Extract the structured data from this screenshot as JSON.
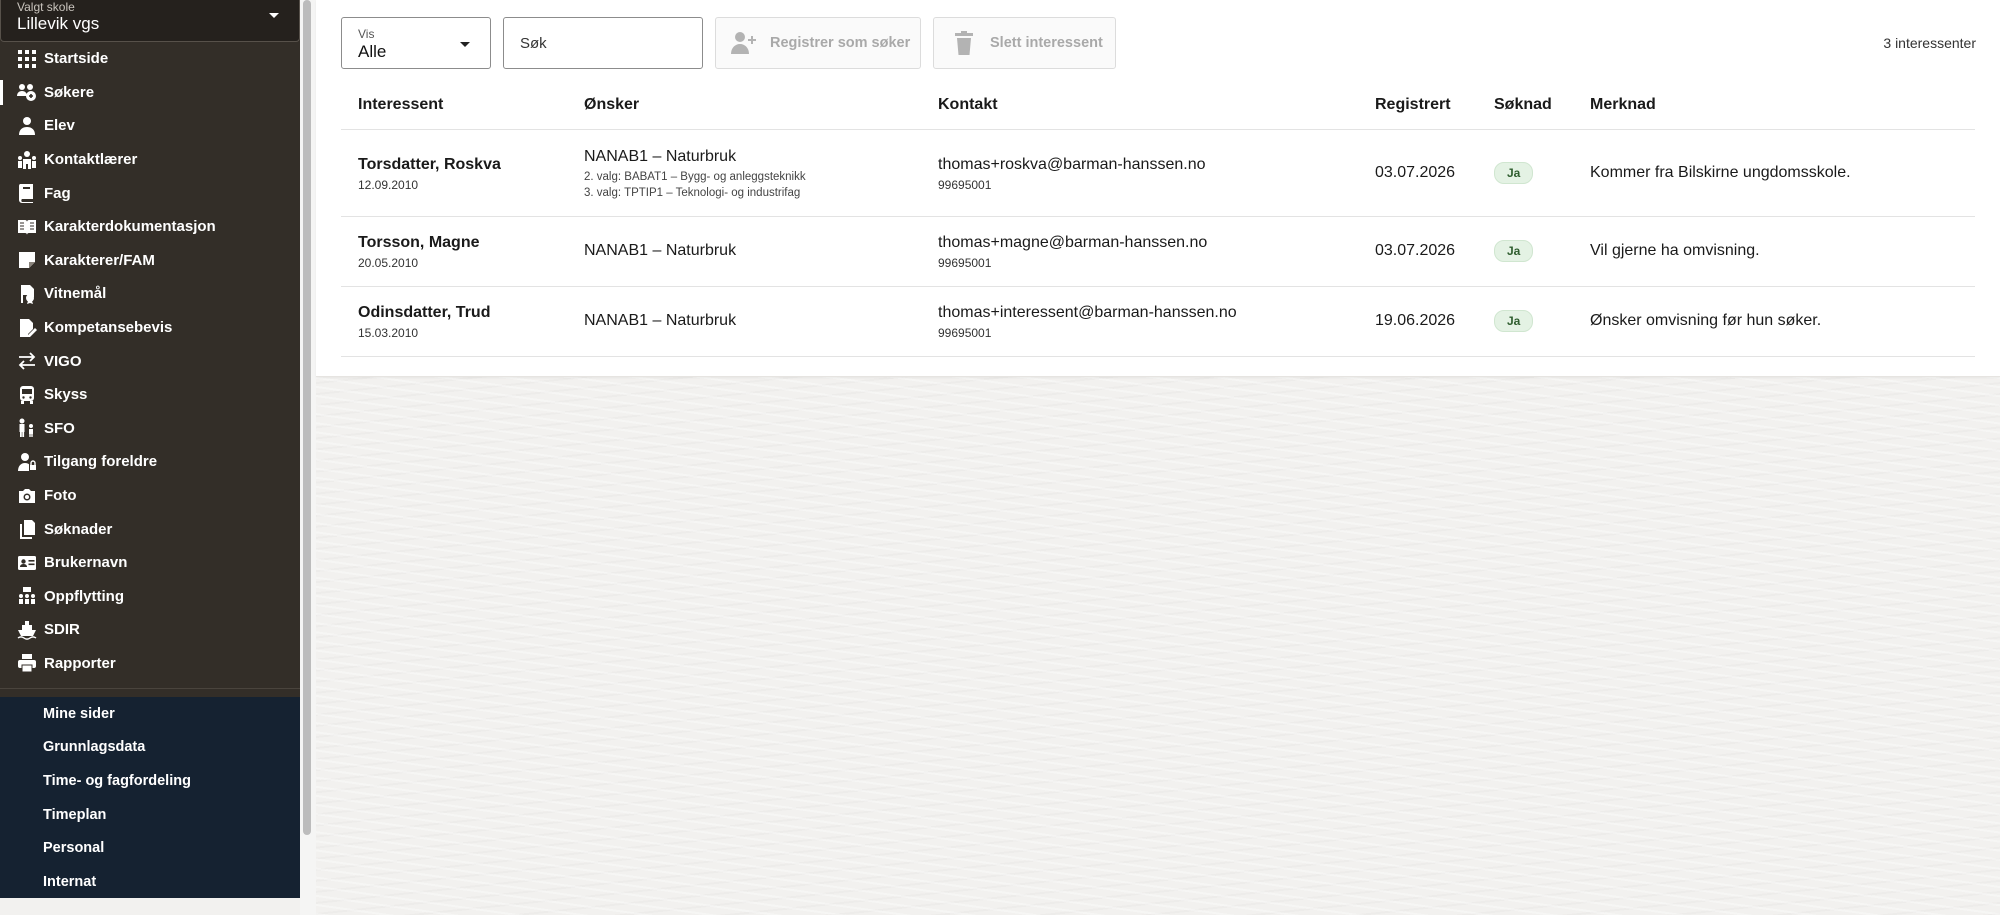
{
  "sidebar": {
    "school_select": {
      "label": "Valgt skole",
      "value": "Lillevik vgs"
    },
    "items": [
      {
        "label": "Startside",
        "icon": "grid-icon"
      },
      {
        "label": "Søkere",
        "icon": "applicants-icon"
      },
      {
        "label": "Elev",
        "icon": "person-icon"
      },
      {
        "label": "Kontaktlærer",
        "icon": "teacher-icon"
      },
      {
        "label": "Fag",
        "icon": "book-icon"
      },
      {
        "label": "Karakterdokumentasjon",
        "icon": "open-book-icon"
      },
      {
        "label": "Karakterer/FAM",
        "icon": "note-icon"
      },
      {
        "label": "Vitnemål",
        "icon": "diploma-icon"
      },
      {
        "label": "Kompetansebevis",
        "icon": "certificate-icon"
      },
      {
        "label": "VIGO",
        "icon": "swap-arrows-icon"
      },
      {
        "label": "Skyss",
        "icon": "bus-icon"
      },
      {
        "label": "SFO",
        "icon": "family-icon"
      },
      {
        "label": "Tilgang foreldre",
        "icon": "user-lock-icon"
      },
      {
        "label": "Foto",
        "icon": "camera-icon"
      },
      {
        "label": "Søknader",
        "icon": "documents-icon"
      },
      {
        "label": "Brukernavn",
        "icon": "id-card-icon"
      },
      {
        "label": "Oppflytting",
        "icon": "classroom-icon"
      },
      {
        "label": "SDIR",
        "icon": "ship-icon"
      },
      {
        "label": "Rapporter",
        "icon": "printer-icon"
      }
    ],
    "active_index": 1,
    "bottom_items": [
      {
        "label": "Mine sider"
      },
      {
        "label": "Grunnlagsdata"
      },
      {
        "label": "Time- og fagfordeling"
      },
      {
        "label": "Timeplan"
      },
      {
        "label": "Personal"
      },
      {
        "label": "Internat"
      }
    ]
  },
  "toolbar": {
    "vis_select": {
      "label": "Vis",
      "value": "Alle"
    },
    "search": {
      "placeholder": "Søk"
    },
    "register_label": "Registrer som søker",
    "delete_label": "Slett interessent",
    "count_text": "3 interessenter"
  },
  "table": {
    "headers": {
      "interessent": "Interessent",
      "onsker": "Ønsker",
      "kontakt": "Kontakt",
      "registrert": "Registrert",
      "soknad": "Søknad",
      "merknad": "Merknad"
    },
    "rows": [
      {
        "name": "Torsdatter, Roskva",
        "birthdate": "12.09.2010",
        "wish": "NANAB1 – Naturbruk",
        "wish_extra": [
          "2. valg: BABAT1 – Bygg- og anleggsteknikk",
          "3. valg: TPTIP1 – Teknologi- og industrifag"
        ],
        "email": "thomas+roskva@barman-hanssen.no",
        "phone": "99695001",
        "registered": "03.07.2026",
        "application": "Ja",
        "note": "Kommer fra Bilskirne ungdomsskole."
      },
      {
        "name": "Torsson, Magne",
        "birthdate": "20.05.2010",
        "wish": "NANAB1 – Naturbruk",
        "wish_extra": [],
        "email": "thomas+magne@barman-hanssen.no",
        "phone": "99695001",
        "registered": "03.07.2026",
        "application": "Ja",
        "note": "Vil gjerne ha omvisning."
      },
      {
        "name": "Odinsdatter, Trud",
        "birthdate": "15.03.2010",
        "wish": "NANAB1 – Naturbruk",
        "wish_extra": [],
        "email": "thomas+interessent@barman-hanssen.no",
        "phone": "99695001",
        "registered": "19.06.2026",
        "application": "Ja",
        "note": "Ønsker omvisning før hun søker."
      }
    ]
  },
  "colors": {
    "sidebar_bg": "#332e28",
    "sidebar_bottom_bg": "#152231",
    "badge_bg": "#e4f2e4",
    "badge_text": "#2f5e2f"
  }
}
